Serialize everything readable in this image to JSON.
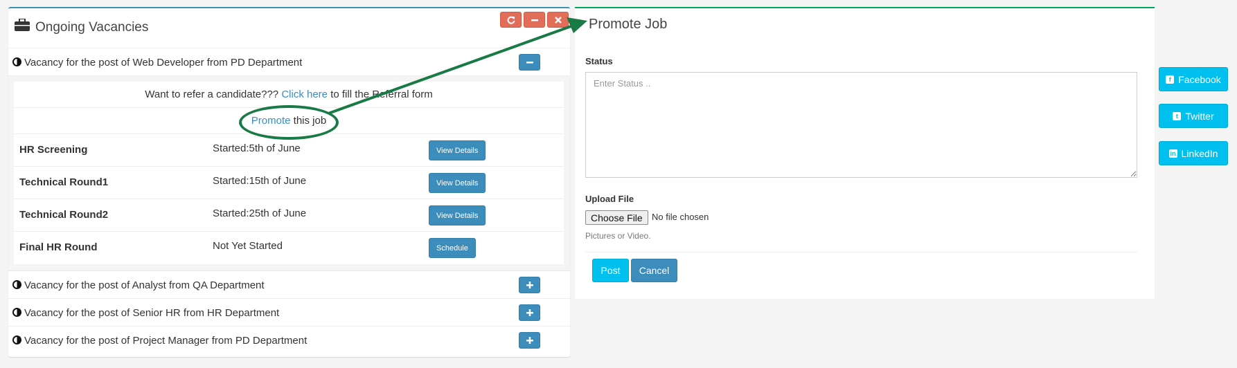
{
  "left_panel": {
    "title": "Ongoing Vacancies",
    "icon": "briefcase-icon",
    "tools": [
      "refresh-icon",
      "minimize-icon",
      "close-icon"
    ],
    "vacancies": [
      {
        "title": "Vacancy for the post of Web Developer from PD Department",
        "toggle": "−",
        "expanded": true
      },
      {
        "title": "Vacancy for the post of Analyst from QA Department",
        "toggle": "+"
      },
      {
        "title": "Vacancy for the post of Senior HR from HR Department",
        "toggle": "+"
      },
      {
        "title": "Vacancy for the post of Project Manager from PD Department",
        "toggle": "+"
      }
    ],
    "referral": {
      "prefix": "Want to refer a candidate???",
      "link": "Click here",
      "suffix": "to fill the Referral form"
    },
    "promote": {
      "link": "Promote",
      "suffix": "this job"
    },
    "stages": [
      {
        "name": "HR Screening",
        "status": "Started:5th of June",
        "button": "View Details"
      },
      {
        "name": "Technical Round1",
        "status": "Started:15th of June",
        "button": "View Details"
      },
      {
        "name": "Technical Round2",
        "status": "Started:25th of June",
        "button": "View Details"
      },
      {
        "name": "Final HR Round",
        "status": "Not Yet Started",
        "button": "Schedule"
      }
    ]
  },
  "right_panel": {
    "title": "Promote Job",
    "status_label": "Status",
    "status_placeholder": "Enter Status ..",
    "upload_label": "Upload File",
    "file_button": "Choose File",
    "file_status": "No file chosen",
    "help_text": "Pictures or Video.",
    "post_button": "Post",
    "cancel_button": "Cancel"
  },
  "social": [
    {
      "label": "Facebook",
      "icon": "facebook-icon",
      "glyph": "f"
    },
    {
      "label": "Twitter",
      "icon": "twitter-icon",
      "glyph": "t"
    },
    {
      "label": "LinkedIn",
      "icon": "linkedin-icon",
      "glyph": "in"
    }
  ],
  "colors": {
    "primary": "#3c8dbc",
    "info": "#00c0ef",
    "danger": "#e26e5a",
    "annotation": "#1a7a45"
  }
}
